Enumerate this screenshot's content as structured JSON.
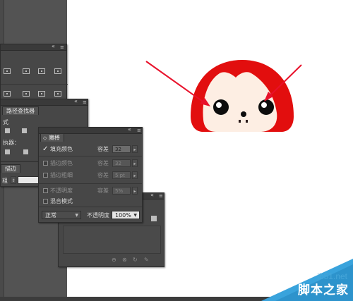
{
  "toolbar_panel": {
    "dock_icon": "«"
  },
  "pathfinder_panel": {
    "tab_label": "路径查找器",
    "mode_label": "式",
    "executor_label": "执器："
  },
  "stroke_panel": {
    "tab_label": "描边",
    "weight_label": "粗"
  },
  "magic_wand": {
    "title": "魔棒",
    "rows": [
      {
        "label": "填充颜色",
        "checked": true,
        "enabled": true,
        "tolerance_label": "容差",
        "value": "32"
      },
      {
        "label": "描边颜色",
        "checked": false,
        "enabled": false,
        "tolerance_label": "容差",
        "value": "32"
      },
      {
        "label": "描边粗细",
        "checked": false,
        "enabled": false,
        "tolerance_label": "容差",
        "value": "5 pt"
      },
      {
        "label": "不透明度",
        "checked": false,
        "enabled": false,
        "tolerance_label": "容差",
        "value": "5%"
      },
      {
        "label": "混合模式",
        "checked": false,
        "enabled": false
      }
    ]
  },
  "transparency_panel": {
    "blend_mode": "正常",
    "opacity_label": "不透明度",
    "opacity_value": "100%"
  },
  "watermark": {
    "domain": "jb51.net",
    "site_name": "脚本之家"
  },
  "colors": {
    "panel": "#474747",
    "arrow": "#e8102a",
    "character_red": "#e20e0e",
    "face": "#fdeee3"
  }
}
